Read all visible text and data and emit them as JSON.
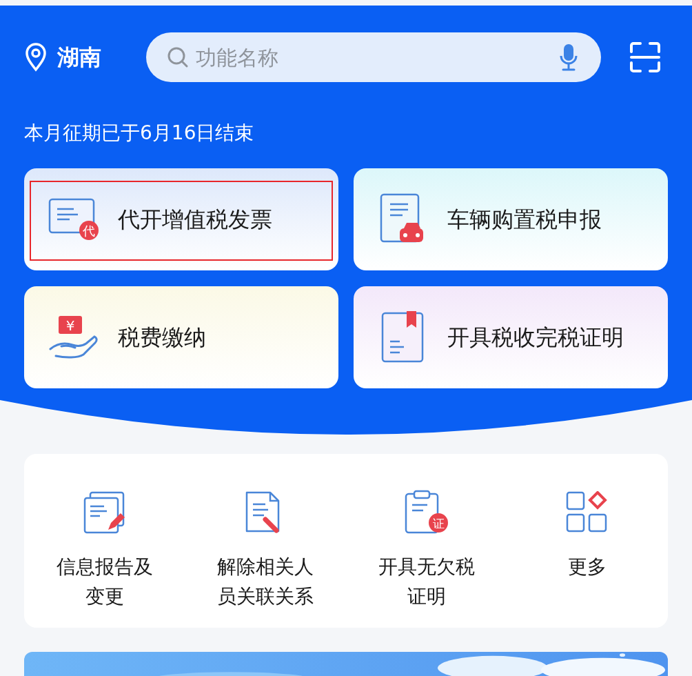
{
  "header": {
    "location": "湖南",
    "search": {
      "placeholder": "功能名称"
    },
    "notice": "本月征期已于6月16日结束"
  },
  "quick_cards": [
    {
      "kind": "invoice",
      "title": "代开增值税发票",
      "badge": "代",
      "highlighted": true,
      "color": "#dde8fb"
    },
    {
      "kind": "car",
      "title": "车辆购置税申报",
      "highlighted": false,
      "color": "#dcf7fa"
    },
    {
      "kind": "pay",
      "title": "税费缴纳",
      "badge": "¥",
      "highlighted": false,
      "color": "#fbf9e6"
    },
    {
      "kind": "certificate",
      "title": "开具税收完税证明",
      "highlighted": false,
      "color": "#f3e8fa"
    }
  ],
  "services": [
    {
      "kind": "report",
      "label": "信息报告及变更"
    },
    {
      "kind": "unlink",
      "label": "解除相关人员关联关系"
    },
    {
      "kind": "clearance",
      "label": "开具无欠税证明",
      "badge": "证"
    },
    {
      "kind": "more",
      "label": "更多"
    }
  ]
}
